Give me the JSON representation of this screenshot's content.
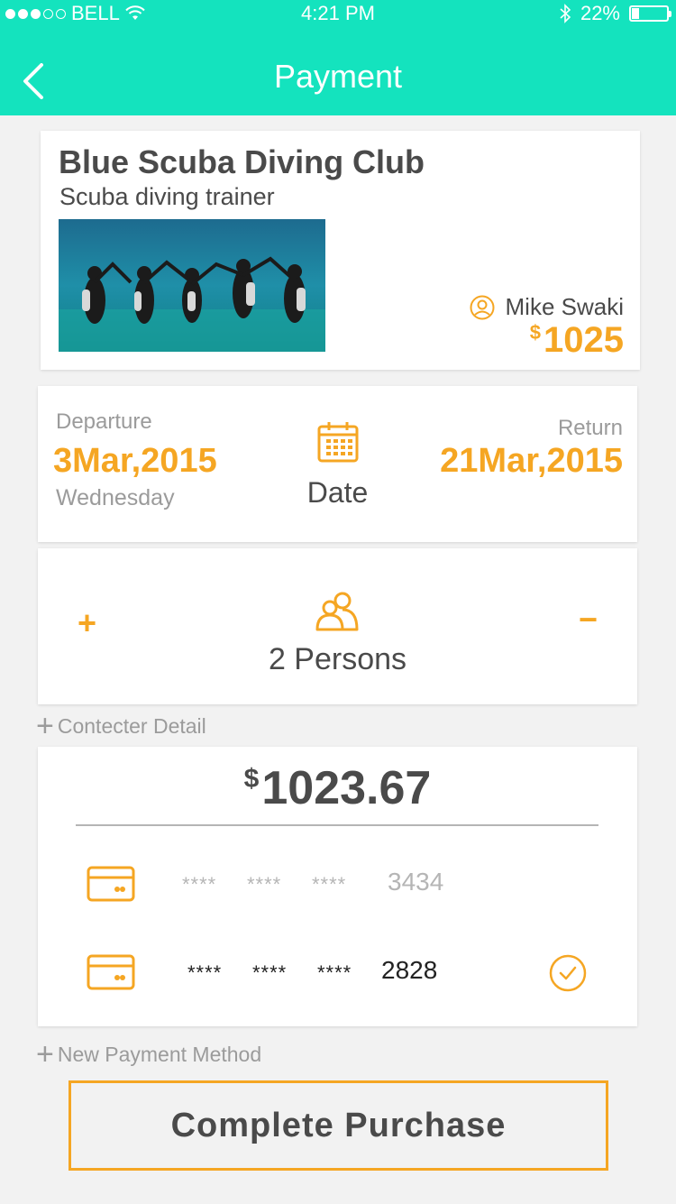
{
  "status_bar": {
    "carrier": "BELL",
    "time": "4:21 PM",
    "battery": "22%",
    "battery_level": 0.22
  },
  "nav": {
    "title": "Payment"
  },
  "club": {
    "name": "Blue Scuba Diving Club",
    "subtitle": "Scuba diving trainer",
    "trainer": "Mike Swaki",
    "currency": "$",
    "price": "1025"
  },
  "dates": {
    "departure_label": "Departure",
    "departure_date": "3Mar,2015",
    "departure_day": "Wednesday",
    "center_label": "Date",
    "return_label": "Return",
    "return_date": "21Mar,2015"
  },
  "persons": {
    "plus": "+",
    "minus": "−",
    "label": "2 Persons"
  },
  "contact_detail_label": "Contecter Detail",
  "payment": {
    "currency": "$",
    "total": "1023.67",
    "cards": [
      {
        "mask": [
          "****",
          "****",
          "****"
        ],
        "last4": "3434",
        "selected": false
      },
      {
        "mask": [
          "****",
          "****",
          "****"
        ],
        "last4": "2828",
        "selected": true
      }
    ]
  },
  "new_payment_label": "New Payment Method",
  "cta": "Complete Purchase",
  "colors": {
    "header": "#14e3be",
    "accent": "#f5a623",
    "text": "#4a4a4a",
    "muted": "#9b9b9b"
  }
}
